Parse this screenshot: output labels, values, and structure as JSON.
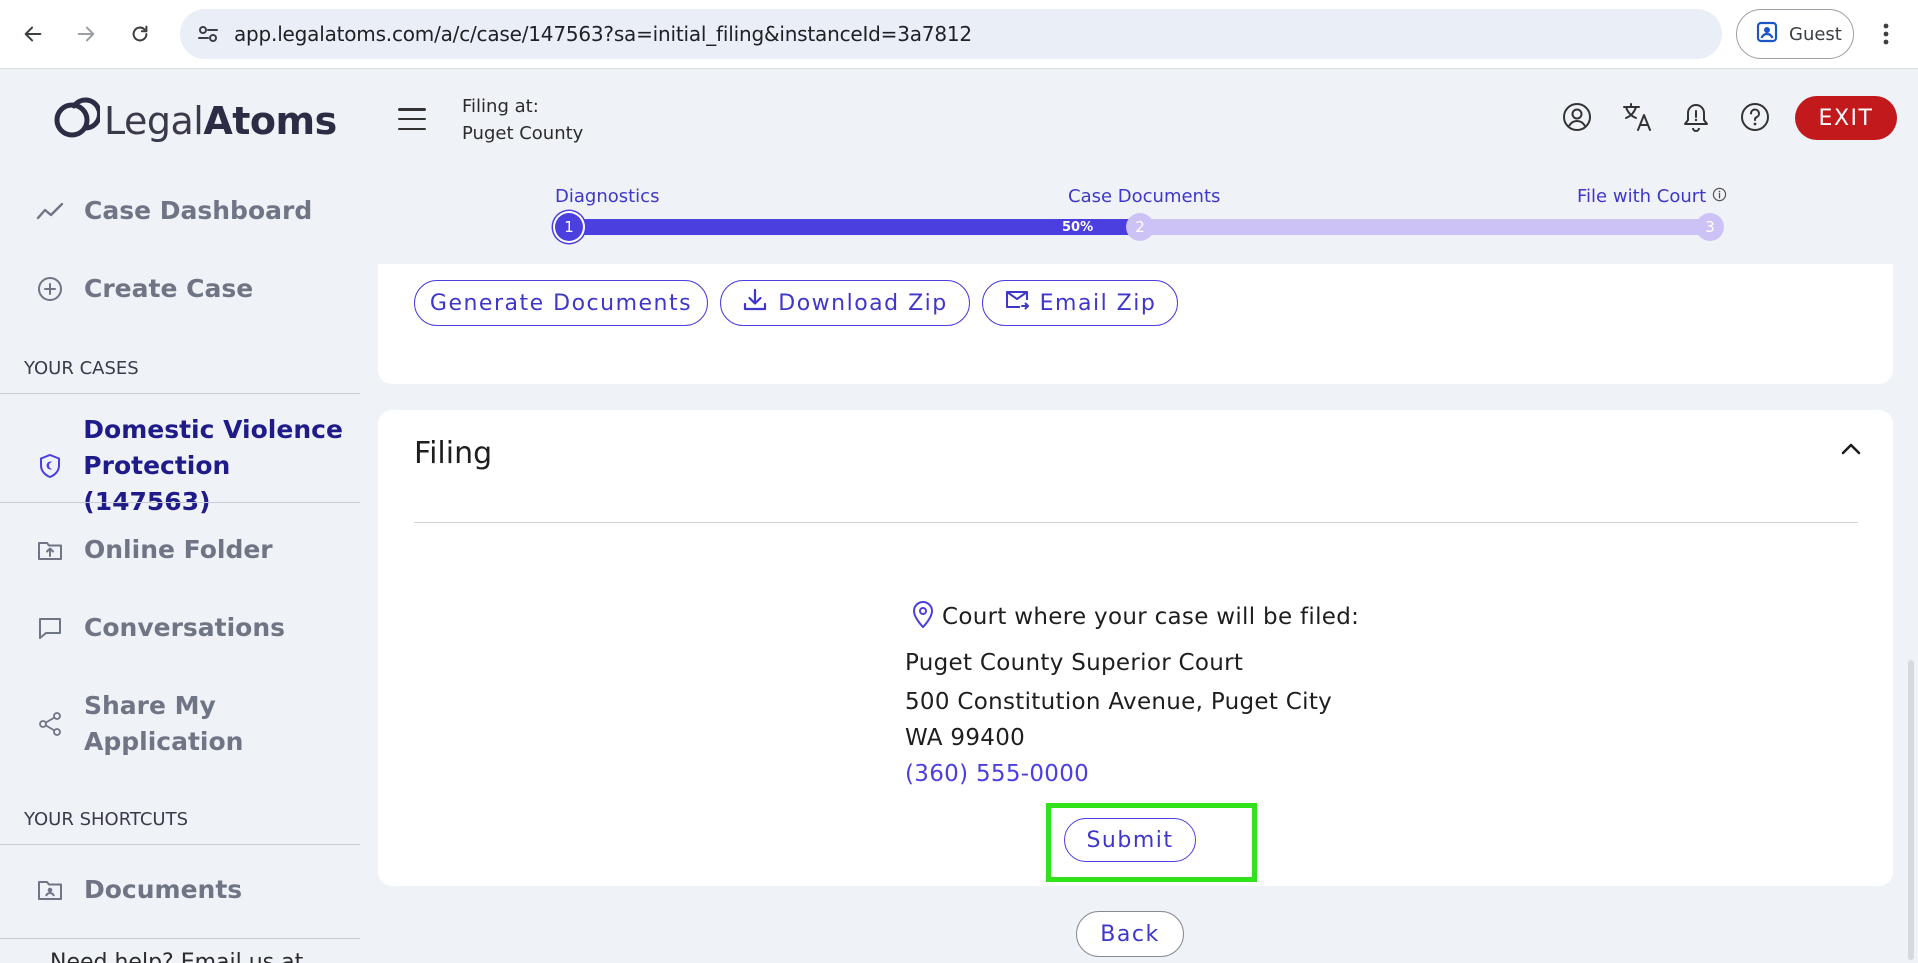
{
  "browser": {
    "url": "app.legalatoms.com/a/c/case/147563?sa=initial_filing&instanceId=3a7812",
    "profile_label": "Guest"
  },
  "brand": {
    "name_part1": "Legal",
    "name_part2": "Atoms"
  },
  "sidebar": {
    "dashboard": "Case Dashboard",
    "create_case": "Create Case",
    "your_cases_heading": "YOUR CASES",
    "active_case_line1": "Domestic Violence",
    "active_case_line2": "Protection (147563)",
    "online_folder": "Online Folder",
    "conversations": "Conversations",
    "share_line1": "Share My",
    "share_line2": "Application",
    "shortcuts_heading": "YOUR SHORTCUTS",
    "documents": "Documents",
    "help_text": "Need help? Email us at"
  },
  "header": {
    "filing_at_label": "Filing at:",
    "filing_at_value": "Puget County",
    "exit_label": "EXIT"
  },
  "stepper": {
    "steps": [
      {
        "number": "1",
        "label": "Diagnostics"
      },
      {
        "number": "2",
        "label": "Case Documents"
      },
      {
        "number": "3",
        "label": "File with Court"
      }
    ],
    "progress_percent": 50,
    "progress_label": "50%"
  },
  "documents_card": {
    "generate_label": "Generate Documents",
    "download_label": "Download Zip",
    "email_label": "Email Zip"
  },
  "filing": {
    "title": "Filing",
    "court_heading": "Court where your case will be filed:",
    "court_name": "Puget County Superior Court",
    "address_line1": "500 Constitution Avenue, Puget City",
    "address_line2": "WA 99400",
    "phone": "(360) 555-0000",
    "submit_label": "Submit"
  },
  "back_label": "Back",
  "colors": {
    "accent": "#4b3fe0",
    "exit_red": "#c2191c",
    "highlight_green": "#2fe21a"
  }
}
